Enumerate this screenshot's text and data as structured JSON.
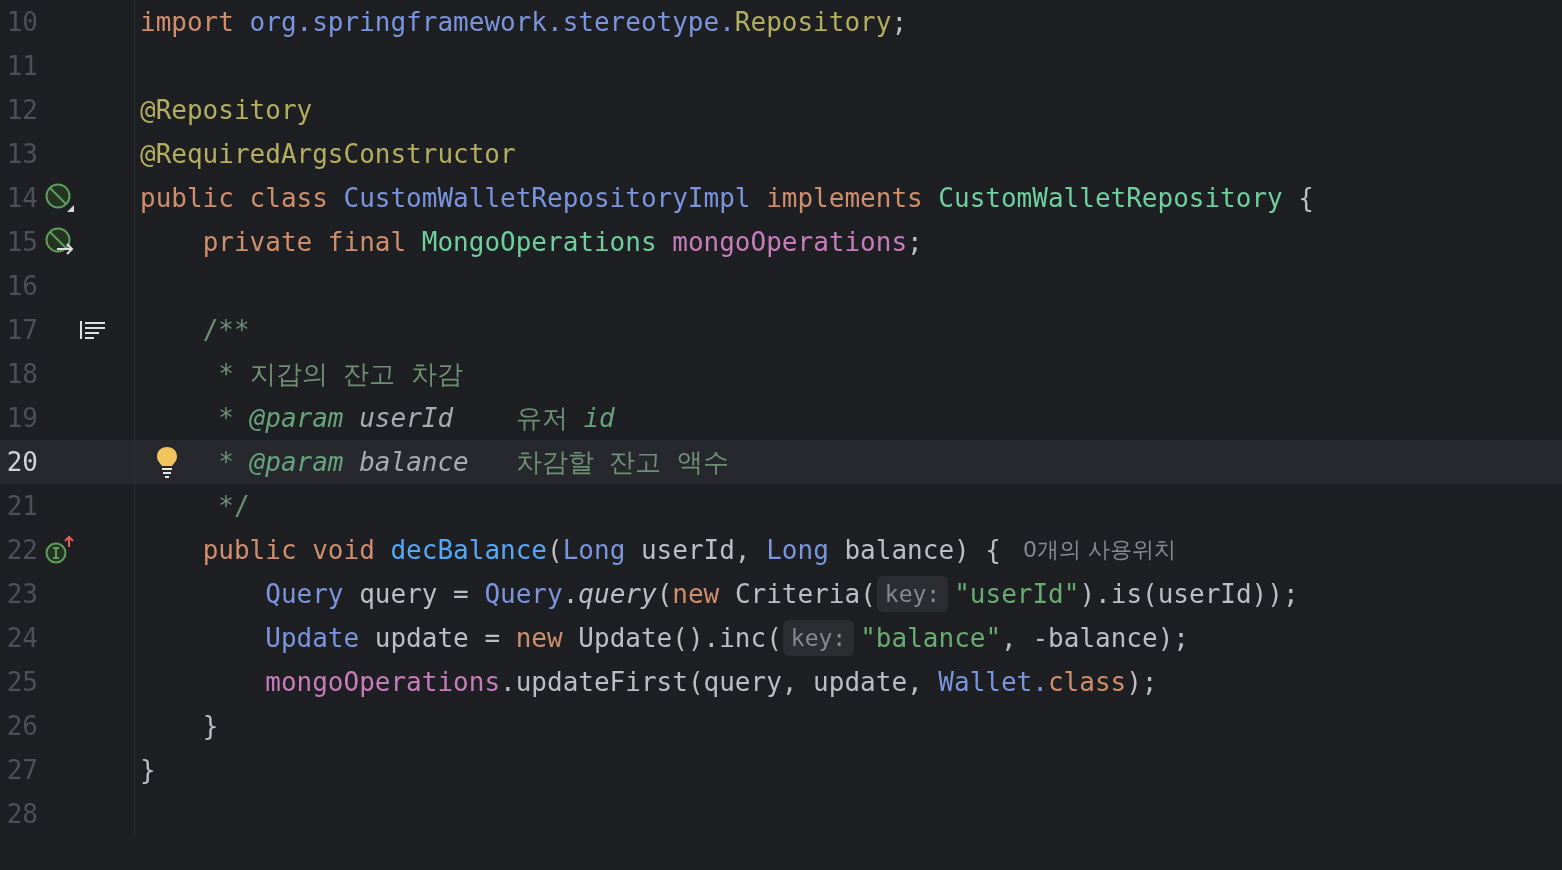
{
  "editor": {
    "lines": [
      {
        "number": "10",
        "current": false,
        "tokens": [
          {
            "text": "import ",
            "kind": "keyword"
          },
          {
            "text": "org.springframework.stereotype.",
            "kind": "type"
          },
          {
            "text": "Repository",
            "kind": "annotation"
          },
          {
            "text": ";",
            "kind": "plain"
          }
        ]
      },
      {
        "number": "11",
        "current": false
      },
      {
        "number": "12",
        "current": false,
        "tokens": [
          {
            "text": "@Repository",
            "kind": "annotation"
          }
        ]
      },
      {
        "number": "13",
        "current": false,
        "tokens": [
          {
            "text": "@RequiredArgsConstructor",
            "kind": "annotation"
          }
        ]
      },
      {
        "number": "14",
        "current": false,
        "gutter_icon": {
          "kind": "bean-corner"
        },
        "tokens": [
          {
            "text": "public class ",
            "kind": "keyword"
          },
          {
            "text": "CustomWalletRepositoryImpl",
            "kind": "type"
          },
          {
            "text": " implements ",
            "kind": "keyword"
          },
          {
            "text": "CustomWalletRepository",
            "kind": "iface"
          },
          {
            "text": " {",
            "kind": "plain"
          }
        ]
      },
      {
        "number": "15",
        "current": false,
        "gutter_icon": {
          "kind": "bean-arrow"
        },
        "tokens": [
          {
            "text": "    private final ",
            "kind": "keyword"
          },
          {
            "text": "MongoOperations",
            "kind": "iface"
          },
          {
            "text": " mongoOperations",
            "kind": "field"
          },
          {
            "text": ";",
            "kind": "plain"
          }
        ]
      },
      {
        "number": "16",
        "current": false
      },
      {
        "number": "17",
        "current": false,
        "gutter_icon": {
          "kind": "doc"
        },
        "tokens": [
          {
            "text": "    /**",
            "kind": "comment"
          }
        ]
      },
      {
        "number": "18",
        "current": false,
        "tokens": [
          {
            "text": "     * 지갑의 잔고 차감",
            "kind": "comment"
          }
        ]
      },
      {
        "number": "19",
        "current": false,
        "tokens": [
          {
            "text": "     * ",
            "kind": "comment"
          },
          {
            "text": "@param",
            "kind": "doctag"
          },
          {
            "text": " userId",
            "kind": "docparam"
          },
          {
            "text": "    유저 ",
            "kind": "comment"
          },
          {
            "text": "id",
            "kind": "doctag"
          }
        ]
      },
      {
        "number": "20",
        "current": true,
        "bulb": true,
        "tokens": [
          {
            "text": "     * ",
            "kind": "comment"
          },
          {
            "text": "@param",
            "kind": "doctag"
          },
          {
            "text": " balance",
            "kind": "docparam"
          },
          {
            "text": "   차감할 잔고 액수",
            "kind": "comment"
          }
        ]
      },
      {
        "number": "21",
        "current": false,
        "tokens": [
          {
            "text": "     */",
            "kind": "comment"
          }
        ]
      },
      {
        "number": "22",
        "current": false,
        "gutter_icon": {
          "kind": "impl-up"
        },
        "tokens": [
          {
            "text": "    public void ",
            "kind": "keyword"
          },
          {
            "text": "decBalance",
            "kind": "method"
          },
          {
            "text": "(",
            "kind": "plain"
          },
          {
            "text": "Long",
            "kind": "type"
          },
          {
            "text": " userId, ",
            "kind": "plain"
          },
          {
            "text": "Long",
            "kind": "type"
          },
          {
            "text": " balance) {",
            "kind": "plain"
          },
          {
            "text": "0개의 사용위치",
            "kind": "usage"
          }
        ]
      },
      {
        "number": "23",
        "current": false,
        "tokens": [
          {
            "text": "        Query",
            "kind": "type"
          },
          {
            "text": " query = ",
            "kind": "plain"
          },
          {
            "text": "Query",
            "kind": "type"
          },
          {
            "text": ".",
            "kind": "plain"
          },
          {
            "text": "query",
            "kind": "static"
          },
          {
            "text": "(",
            "kind": "plain"
          },
          {
            "text": "new ",
            "kind": "keyword"
          },
          {
            "text": "Criteria(",
            "kind": "plain"
          },
          {
            "text": "key:",
            "kind": "inlay"
          },
          {
            "text": "\"userId\"",
            "kind": "string"
          },
          {
            "text": ").is(userId));",
            "kind": "plain"
          }
        ]
      },
      {
        "number": "24",
        "current": false,
        "tokens": [
          {
            "text": "        Update",
            "kind": "type"
          },
          {
            "text": " update = ",
            "kind": "plain"
          },
          {
            "text": "new ",
            "kind": "keyword"
          },
          {
            "text": "Update().inc(",
            "kind": "plain"
          },
          {
            "text": "key:",
            "kind": "inlay"
          },
          {
            "text": "\"balance\"",
            "kind": "string"
          },
          {
            "text": ", -balance);",
            "kind": "plain"
          }
        ]
      },
      {
        "number": "25",
        "current": false,
        "tokens": [
          {
            "text": "        mongoOperations",
            "kind": "field"
          },
          {
            "text": ".updateFirst(query, update, ",
            "kind": "plain"
          },
          {
            "text": "Wallet.",
            "kind": "type"
          },
          {
            "text": "class",
            "kind": "keyword"
          },
          {
            "text": ");",
            "kind": "plain"
          }
        ]
      },
      {
        "number": "26",
        "current": false,
        "tokens": [
          {
            "text": "    }",
            "kind": "plain"
          }
        ]
      },
      {
        "number": "27",
        "current": false,
        "tokens": [
          {
            "text": "}",
            "kind": "plain"
          }
        ]
      },
      {
        "number": "28",
        "current": false
      }
    ]
  }
}
